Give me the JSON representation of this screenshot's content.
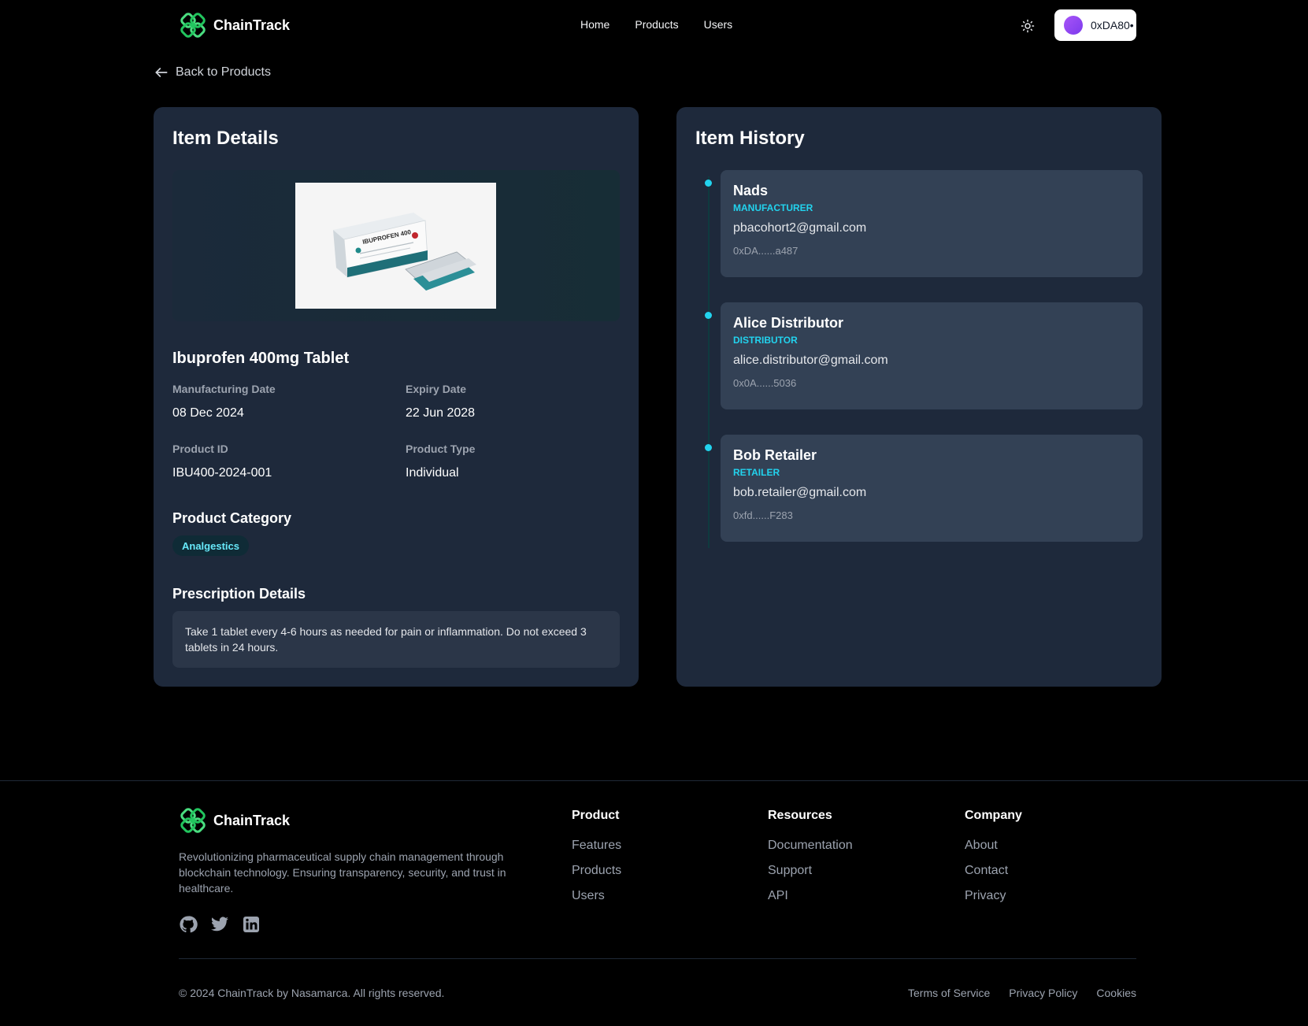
{
  "header": {
    "brand": "ChainTrack",
    "nav": [
      "Home",
      "Products",
      "Users"
    ],
    "wallet_address": "0xDA80•"
  },
  "back_link": "Back to Products",
  "details": {
    "title": "Item Details",
    "product_name": "Ibuprofen 400mg Tablet",
    "image_text": "IBUPROFEN 400",
    "manufacturing_date_label": "Manufacturing Date",
    "manufacturing_date": "08 Dec 2024",
    "expiry_date_label": "Expiry Date",
    "expiry_date": "22 Jun 2028",
    "product_id_label": "Product ID",
    "product_id": "IBU400-2024-001",
    "product_type_label": "Product Type",
    "product_type": "Individual",
    "category_title": "Product Category",
    "category": "Analgestics",
    "prescription_title": "Prescription Details",
    "prescription": "Take 1 tablet every 4-6 hours as needed for pain or inflammation. Do not exceed 3 tablets in 24 hours."
  },
  "history": {
    "title": "Item History",
    "entries": [
      {
        "name": "Nads",
        "role": "MANUFACTURER",
        "email": "pbacohort2@gmail.com",
        "address": "0xDA......a487"
      },
      {
        "name": "Alice Distributor",
        "role": "DISTRIBUTOR",
        "email": "alice.distributor@gmail.com",
        "address": "0x0A......5036"
      },
      {
        "name": "Bob Retailer",
        "role": "RETAILER",
        "email": "bob.retailer@gmail.com",
        "address": "0xfd......F283"
      }
    ]
  },
  "footer": {
    "brand": "ChainTrack",
    "description": "Revolutionizing pharmaceutical supply chain management through blockchain technology. Ensuring transparency, security, and trust in healthcare.",
    "columns": [
      {
        "title": "Product",
        "links": [
          "Features",
          "Products",
          "Users"
        ]
      },
      {
        "title": "Resources",
        "links": [
          "Documentation",
          "Support",
          "API"
        ]
      },
      {
        "title": "Company",
        "links": [
          "About",
          "Contact",
          "Privacy"
        ]
      }
    ],
    "copyright": "© 2024 ChainTrack by Nasamarca. All rights reserved.",
    "legal": [
      "Terms of Service",
      "Privacy Policy",
      "Cookies"
    ]
  },
  "colors": {
    "accent": "#22d3ee",
    "card": "#1e293b",
    "logo": "#4ade80"
  },
  "icons": [
    "logo-icon",
    "sun-icon",
    "arrow-left-icon",
    "github-icon",
    "twitter-icon",
    "linkedin-icon"
  ]
}
